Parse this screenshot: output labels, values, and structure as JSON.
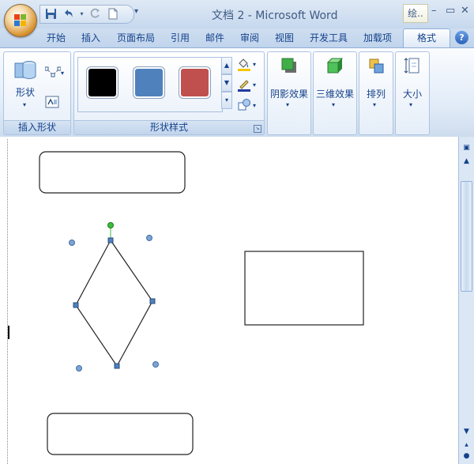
{
  "window": {
    "title": "文档 2 - Microsoft Word",
    "helper_tab": "绘..",
    "controls": {
      "minimize": "–",
      "restore": "▭",
      "close": "✕"
    }
  },
  "quick_access": {
    "save": "save-icon",
    "undo": "undo-icon",
    "redo": "redo-icon",
    "new": "new-document-icon",
    "more": "▾"
  },
  "tabs": [
    {
      "label": "开始"
    },
    {
      "label": "插入"
    },
    {
      "label": "页面布局"
    },
    {
      "label": "引用"
    },
    {
      "label": "邮件"
    },
    {
      "label": "审阅"
    },
    {
      "label": "视图"
    },
    {
      "label": "开发工具"
    },
    {
      "label": "加载项"
    },
    {
      "label": "格式",
      "active": true
    }
  ],
  "help_label": "?",
  "ribbon": {
    "insert_shapes": {
      "group_label": "插入形状",
      "shapes_label": "形状"
    },
    "shape_styles": {
      "group_label": "形状样式",
      "swatches": [
        "#000000",
        "#4f81bd",
        "#c0504d"
      ]
    },
    "shadow_effects": {
      "label": "阴影效果"
    },
    "3d_effects": {
      "label": "三维效果"
    },
    "arrange": {
      "label": "排列"
    },
    "size": {
      "label": "大小"
    }
  },
  "colors": {
    "ribbon_text": "#15428b",
    "handle_fill": "#4f81bd",
    "rotate_handle": "#3cbc3c"
  }
}
